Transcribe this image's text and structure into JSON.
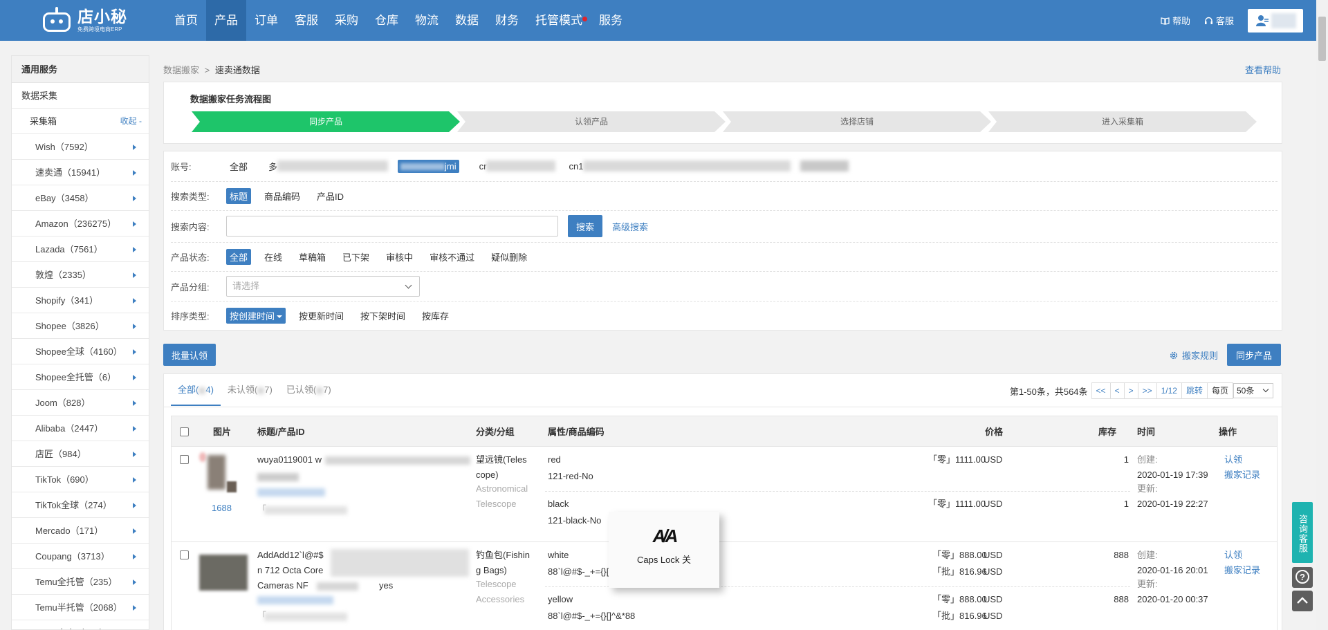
{
  "header": {
    "logo_text": "店小秘",
    "logo_sub": "免费跨境电商ERP",
    "nav": [
      "首页",
      "产品",
      "订单",
      "客服",
      "采购",
      "仓库",
      "物流",
      "数据",
      "财务",
      "托管模式",
      "服务"
    ],
    "help": "帮助",
    "service": "客服"
  },
  "sidebar": {
    "section": "通用服务",
    "group": "数据采集",
    "box_label": "采集箱",
    "collapse": "收起 -",
    "items": [
      "Wish（7592）",
      "速卖通（15941）",
      "eBay（3458）",
      "Amazon（236275）",
      "Lazada（7561）",
      "敦煌（2335）",
      "Shopify（341）",
      "Shopee（3826）",
      "Shopee全球（4160）",
      "Shopee全托管（6）",
      "Joom（828）",
      "Alibaba（2447）",
      "店匠（984）",
      "TikTok（690）",
      "TikTok全球（274）",
      "Mercado（171）",
      "Coupang（3713）",
      "Temu全托管（235）",
      "Temu半托管（2068）",
      "Temu本土（170）"
    ]
  },
  "breadcrumb": {
    "parent": "数据搬家",
    "sep": ">",
    "current": "速卖通数据"
  },
  "view_help": "查看帮助",
  "flow": {
    "title": "数据搬家任务流程图",
    "steps": [
      "同步产品",
      "认领产品",
      "选择店铺",
      "进入采集箱"
    ]
  },
  "filters": {
    "account_label": "账号:",
    "account_all": "全部",
    "account_visible": [
      "多",
      "cn",
      "jmi",
      "cr",
      "cn1"
    ],
    "search_type_label": "搜索类型:",
    "search_types": [
      "标题",
      "商品编码",
      "产品ID"
    ],
    "search_content_label": "搜索内容:",
    "search_btn": "搜索",
    "advanced": "高级搜索",
    "status_label": "产品状态:",
    "statuses": [
      "全部",
      "在线",
      "草稿箱",
      "已下架",
      "审核中",
      "审核不通过",
      "疑似删除"
    ],
    "group_label": "产品分组:",
    "group_placeholder": "请选择",
    "sort_label": "排序类型:",
    "sorts": [
      "按创建时间",
      "按更新时间",
      "按下架时间",
      "按库存"
    ]
  },
  "actions": {
    "batch_claim": "批量认领",
    "rules": "搬家规则",
    "sync": "同步产品"
  },
  "tabs": [
    "全部(",
    "未认领(",
    "已认领("
  ],
  "tab_suffix": [
    "4)",
    "7)",
    "7)"
  ],
  "pager": {
    "info": "第1-50条，共564条",
    "buttons": [
      "<<",
      "<",
      ">",
      ">>",
      "1/12",
      "跳转"
    ],
    "per_page_label": "每页",
    "per_page": "50条"
  },
  "table": {
    "headers": [
      "图片",
      "标题/产品ID",
      "分类/分组",
      "属性/商品编码",
      "价格",
      "库存",
      "时间",
      "操作"
    ],
    "rows": [
      {
        "img_label": "1688",
        "title": "wuya0119001  w",
        "id_prefix": "「",
        "category": "望远镜(Telescope)",
        "group": "Astronomical Telescope",
        "variants": [
          {
            "attr": "red",
            "code": "121-red-No",
            "prices": [
              [
                "「零」1111.00",
                "USD"
              ]
            ],
            "stock": "1"
          },
          {
            "attr": "black",
            "code": "121-black-No",
            "prices": [
              [
                "「零」1111.00",
                "USD"
              ]
            ],
            "stock": "1"
          }
        ],
        "created_label": "创建:",
        "created": "2020-01-19 17:39",
        "updated_label": "更新:",
        "updated": "2020-01-19 22:27",
        "ops": [
          "认领",
          "搬家记录"
        ]
      },
      {
        "title_l1": "AddAdd12`l@#$",
        "title_l2": "n 712 Octa Core",
        "title_l3": "Cameras NF",
        "title_end": "yes",
        "id_prefix": "「",
        "category": "钓鱼包(Fishing Bags)",
        "group": "Telescope Accessories",
        "variants": [
          {
            "attr": "white",
            "code": "88`l@#$-_+={}[]",
            "prices": [
              [
                "「零」888.00",
                "USD"
              ],
              [
                "「批」816.96",
                "USD"
              ]
            ],
            "stock": "888"
          },
          {
            "attr": "yellow",
            "code": "88`l@#$-_+={}[]^&*88",
            "prices": [
              [
                "「零」888.00",
                "USD"
              ],
              [
                "「批」816.96",
                "USD"
              ]
            ],
            "stock": "888"
          }
        ],
        "created_label": "创建:",
        "created": "2020-01-16 20:01",
        "updated_label": "更新:",
        "updated": "2020-01-20 00:37",
        "ops": [
          "认领",
          "搬家记录"
        ]
      }
    ]
  },
  "caps_lock": {
    "glyph": "A/A",
    "label": "Caps Lock 关"
  },
  "consult": "咨询客服",
  "float_help": "?",
  "float_top": "^"
}
